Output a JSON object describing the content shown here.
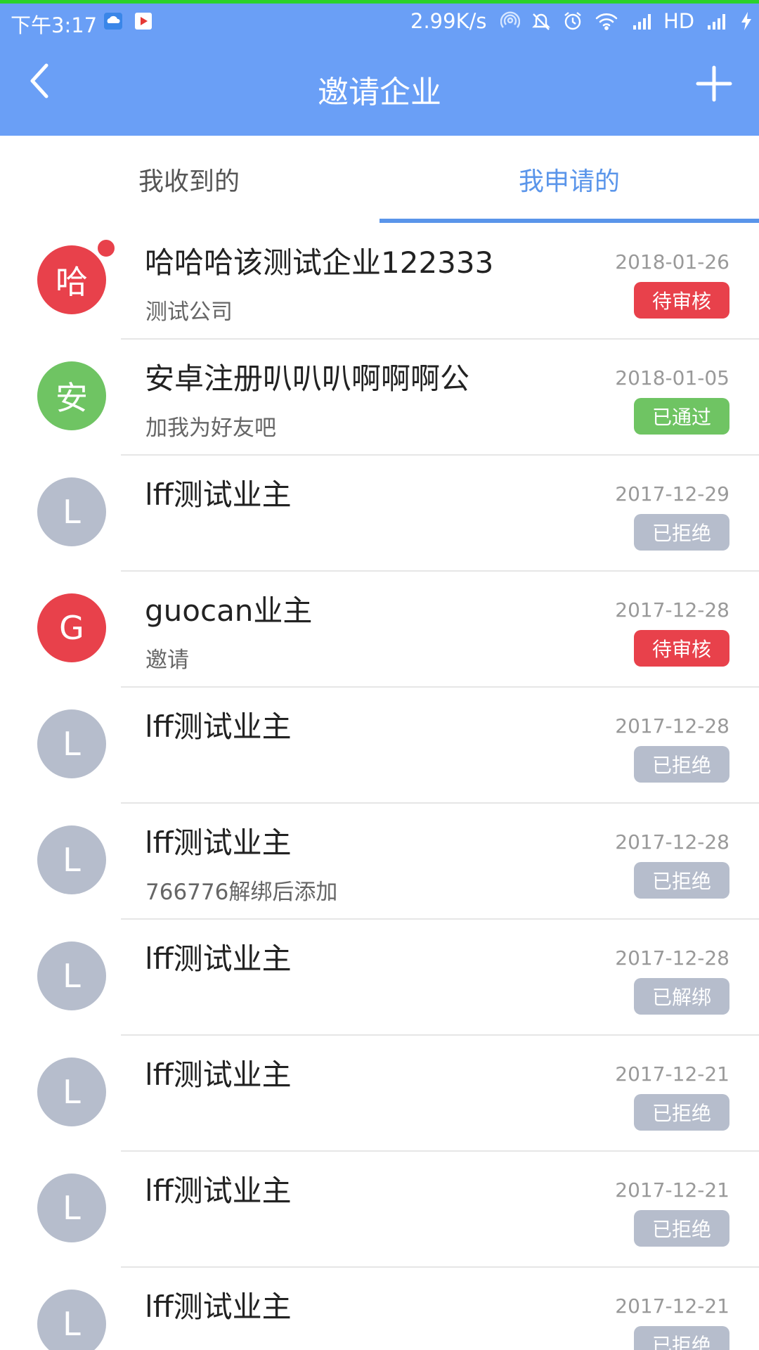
{
  "status_bar": {
    "time": "下午3:17",
    "net_speed": "2.99K/s",
    "hd_label": "HD",
    "icons": [
      "cloud-app-icon",
      "play-store-icon",
      "hotspot-icon",
      "mute-icon",
      "alarm-icon",
      "wifi-icon",
      "signal-icon",
      "signal-icon",
      "charging-icon"
    ]
  },
  "app_bar": {
    "title": "邀请企业",
    "back_icon": "chevron-left-icon",
    "add_icon": "plus-icon",
    "color": "#6a9ff6"
  },
  "tabs": [
    {
      "label": "我收到的",
      "active": false
    },
    {
      "label": "我申请的",
      "active": true
    }
  ],
  "status_colors": {
    "pending": "#e8414b",
    "approved": "#6fc463",
    "rejected": "#b6bdcc",
    "unbound": "#b6bdcc"
  },
  "items": [
    {
      "avatar_text": "哈",
      "avatar_color": "#e8414b",
      "unread": true,
      "title": "哈哈哈该测试企业122333",
      "subtitle": "测试公司",
      "date": "2018-01-26",
      "status": "待审核",
      "status_color": "#e8414b"
    },
    {
      "avatar_text": "安",
      "avatar_color": "#6fc463",
      "unread": false,
      "title": "安卓注册叭叭叭啊啊啊公",
      "subtitle": "加我为好友吧",
      "date": "2018-01-05",
      "status": "已通过",
      "status_color": "#6fc463"
    },
    {
      "avatar_text": "L",
      "avatar_color": "#b6bdcc",
      "unread": false,
      "title": "lff测试业主",
      "subtitle": "",
      "date": "2017-12-29",
      "status": "已拒绝",
      "status_color": "#b6bdcc"
    },
    {
      "avatar_text": "G",
      "avatar_color": "#e8414b",
      "unread": false,
      "title": "guocan业主",
      "subtitle": "邀请",
      "date": "2017-12-28",
      "status": "待审核",
      "status_color": "#e8414b"
    },
    {
      "avatar_text": "L",
      "avatar_color": "#b6bdcc",
      "unread": false,
      "title": "lff测试业主",
      "subtitle": "",
      "date": "2017-12-28",
      "status": "已拒绝",
      "status_color": "#b6bdcc"
    },
    {
      "avatar_text": "L",
      "avatar_color": "#b6bdcc",
      "unread": false,
      "title": "lff测试业主",
      "subtitle": "766776解绑后添加",
      "date": "2017-12-28",
      "status": "已拒绝",
      "status_color": "#b6bdcc"
    },
    {
      "avatar_text": "L",
      "avatar_color": "#b6bdcc",
      "unread": false,
      "title": "lff测试业主",
      "subtitle": "",
      "date": "2017-12-28",
      "status": "已解绑",
      "status_color": "#b6bdcc"
    },
    {
      "avatar_text": "L",
      "avatar_color": "#b6bdcc",
      "unread": false,
      "title": "lff测试业主",
      "subtitle": "",
      "date": "2017-12-21",
      "status": "已拒绝",
      "status_color": "#b6bdcc"
    },
    {
      "avatar_text": "L",
      "avatar_color": "#b6bdcc",
      "unread": false,
      "title": "lff测试业主",
      "subtitle": "",
      "date": "2017-12-21",
      "status": "已拒绝",
      "status_color": "#b6bdcc"
    },
    {
      "avatar_text": "L",
      "avatar_color": "#b6bdcc",
      "unread": false,
      "title": "lff测试业主",
      "subtitle": "",
      "date": "2017-12-21",
      "status": "已拒绝",
      "status_color": "#b6bdcc"
    }
  ]
}
